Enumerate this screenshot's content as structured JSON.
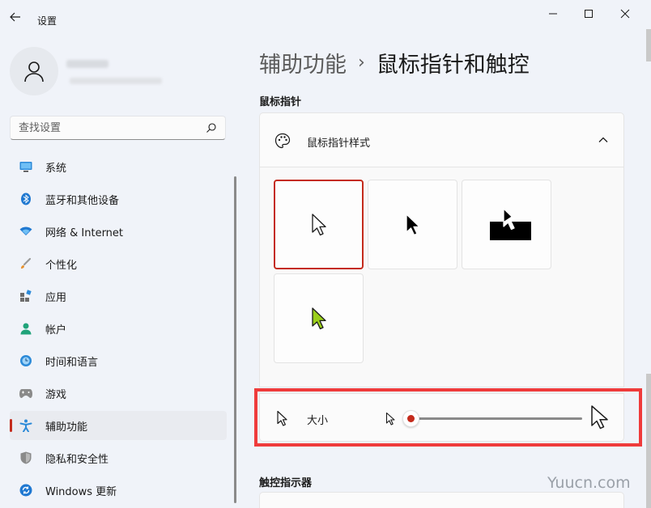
{
  "titlebar": {
    "title": "设置"
  },
  "search": {
    "placeholder": "查找设置"
  },
  "sidebar": {
    "items": [
      {
        "label": "系统"
      },
      {
        "label": "蓝牙和其他设备"
      },
      {
        "label": "网络 & Internet"
      },
      {
        "label": "个性化"
      },
      {
        "label": "应用"
      },
      {
        "label": "帐户"
      },
      {
        "label": "时间和语言"
      },
      {
        "label": "游戏"
      },
      {
        "label": "辅助功能"
      },
      {
        "label": "隐私和安全性"
      },
      {
        "label": "Windows 更新"
      }
    ],
    "active_index": 8
  },
  "breadcrumb": {
    "parent": "辅助功能",
    "separator": "›",
    "current": "鼠标指针和触控"
  },
  "section": {
    "label": "鼠标指针"
  },
  "pointer_style": {
    "label": "鼠标指针样式",
    "styles": [
      {
        "name": "white",
        "fill": "#ffffff",
        "stroke": "#1a1a1a",
        "selected": true
      },
      {
        "name": "black",
        "fill": "#000000",
        "stroke": "#ffffff",
        "selected": false
      },
      {
        "name": "inverted",
        "fill": "#ffffff",
        "stroke": "#000000",
        "selected": false
      },
      {
        "name": "custom",
        "fill": "#9bd019",
        "stroke": "#1a1a1a",
        "selected": false
      }
    ]
  },
  "size": {
    "label": "大小",
    "value_fraction": 0.0
  },
  "touch": {
    "label": "触控指示器"
  },
  "watermark": "Yuucn.com",
  "colors": {
    "accent": "#c42b1c",
    "highlight": "#ef3b3b",
    "background": "#f0f3f9"
  }
}
